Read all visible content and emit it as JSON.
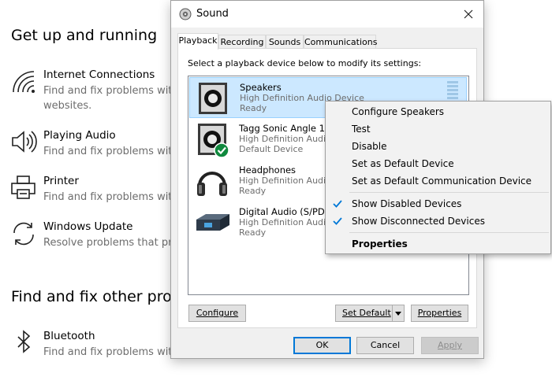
{
  "settings_page": {
    "section1_title": "Get up and running",
    "section2_title": "Find and fix other prob",
    "items": [
      {
        "icon": "wifi-icon",
        "title": "Internet Connections",
        "desc1": "Find and fix problems with",
        "desc2": "websites."
      },
      {
        "icon": "speaker-icon",
        "title": "Playing Audio",
        "desc1": "Find and fix problems with",
        "desc2": ""
      },
      {
        "icon": "printer-icon",
        "title": "Printer",
        "desc1": "Find and fix problems with",
        "desc2": ""
      },
      {
        "icon": "update-icon",
        "title": "Windows Update",
        "desc1": "Resolve problems that pre",
        "desc2": ""
      },
      {
        "icon": "bluetooth-icon",
        "title": "Bluetooth",
        "desc1": "Find and fix problems with",
        "desc2": ""
      }
    ]
  },
  "dialog": {
    "title": "Sound",
    "tabs": [
      {
        "label": "Playback",
        "active": true
      },
      {
        "label": "Recording",
        "active": false
      },
      {
        "label": "Sounds",
        "active": false
      },
      {
        "label": "Communications",
        "active": false
      }
    ],
    "instruction": "Select a playback device below to modify its settings:",
    "devices": [
      {
        "name": "Speakers",
        "description": "High Definition Audio Device",
        "status": "Ready",
        "selected": true,
        "icon": "speaker-device-icon"
      },
      {
        "name": "Tagg Sonic Angle 1",
        "description": "High Definition Audio Device",
        "status": "Default Device",
        "selected": false,
        "icon": "speaker-default-icon"
      },
      {
        "name": "Headphones",
        "description": "High Definition Audio Device",
        "status": "Ready",
        "selected": false,
        "icon": "headphones-icon"
      },
      {
        "name": "Digital Audio (S/PDIF)",
        "description": "High Definition Audio Device",
        "status": "Ready",
        "selected": false,
        "icon": "digital-audio-icon"
      }
    ],
    "buttons": {
      "configure": "Configure",
      "set_default": "Set Default",
      "properties": "Properties",
      "ok": "OK",
      "cancel": "Cancel",
      "apply": "Apply"
    }
  },
  "context_menu": {
    "items": [
      {
        "label": "Configure Speakers",
        "checked": false,
        "bold": false
      },
      {
        "label": "Test",
        "checked": false,
        "bold": false
      },
      {
        "label": "Disable",
        "checked": false,
        "bold": false
      },
      {
        "label": "Set as Default Device",
        "checked": false,
        "bold": false
      },
      {
        "label": "Set as Default Communication Device",
        "checked": false,
        "bold": false
      },
      {
        "label": "Show Disabled Devices",
        "checked": true,
        "bold": false
      },
      {
        "label": "Show Disconnected Devices",
        "checked": true,
        "bold": false
      },
      {
        "label": "Properties",
        "checked": false,
        "bold": true
      }
    ]
  },
  "colors": {
    "selection": "#cce8ff",
    "accent": "#0078d7",
    "default_check": "#10893e"
  }
}
